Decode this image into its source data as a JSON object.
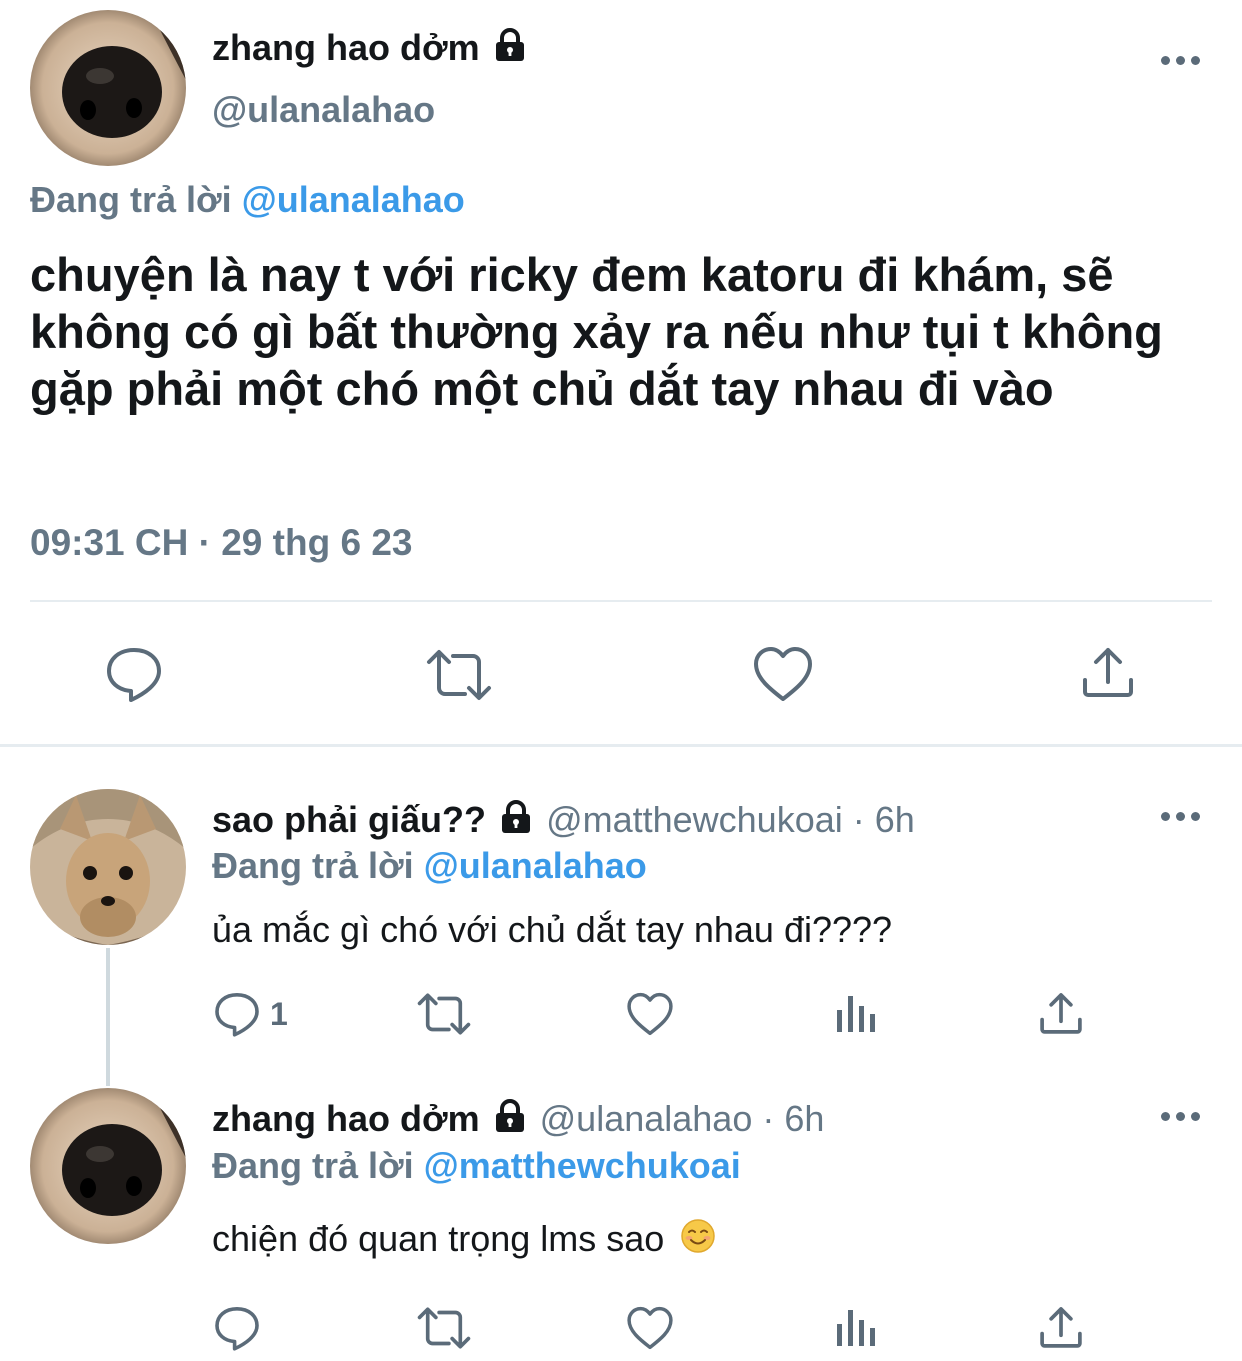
{
  "main_tweet": {
    "display_name": "zhang hao dởm",
    "handle": "@ulanalahao",
    "replying_prefix": "Đang trả lời",
    "replying_to": "@ulanalahao",
    "text": "chuyện là nay t với ricky đem katoru đi khám, sẽ không có gì bất thường xảy ra nếu như tụi t không gặp phải một chó một chủ dắt tay nhau đi vào",
    "timestamp": "09:31 CH · 29 thg 6 23",
    "actions": [
      "reply-icon",
      "retweet-icon",
      "like-icon",
      "share-icon"
    ]
  },
  "replies": [
    {
      "display_name": "sao phải giấu??",
      "handle": "@matthewchukoai",
      "time": "· 6h",
      "replying_prefix": "Đang trả lời",
      "replying_to": "@ulanalahao",
      "text": "ủa mắc gì chó với chủ dắt tay nhau đi????",
      "reply_count": "1",
      "actions": [
        "reply-icon",
        "retweet-icon",
        "like-icon",
        "analytics-icon",
        "share-icon"
      ]
    },
    {
      "display_name": "zhang hao dởm",
      "handle": "@ulanalahao",
      "time": "· 6h",
      "replying_prefix": "Đang trả lời",
      "replying_to": "@matthewchukoai",
      "text": "chiện đó quan trọng lms sao",
      "emoji": "☺️",
      "reply_count": "",
      "actions": [
        "reply-icon",
        "retweet-icon",
        "like-icon",
        "analytics-icon",
        "share-icon"
      ]
    }
  ],
  "colors": {
    "accent": "#3b9ae8",
    "muted": "#657786",
    "text": "#14171a",
    "divider": "#e6ecf0"
  }
}
